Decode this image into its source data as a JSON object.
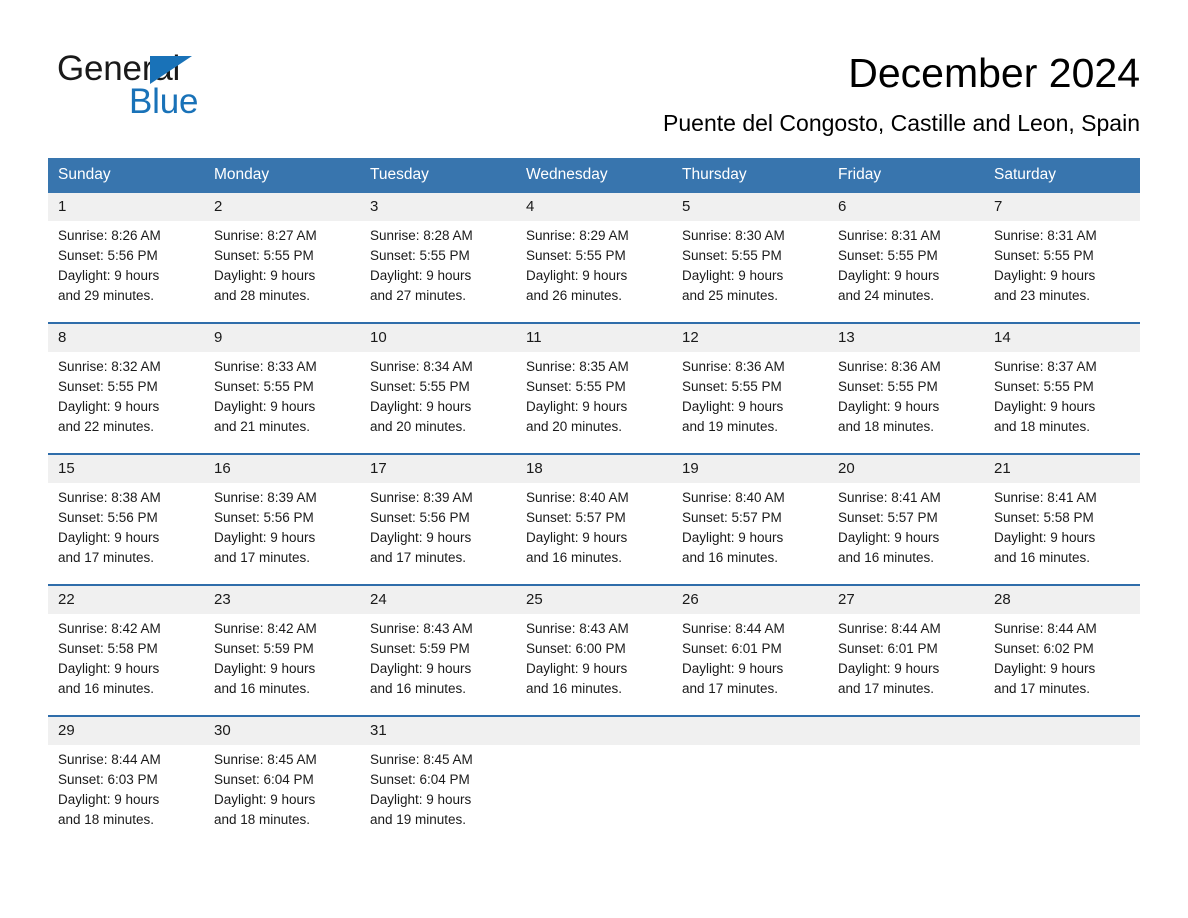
{
  "brand": {
    "name_part1": "General",
    "name_part2": "Blue",
    "triangle_color": "#1972b8"
  },
  "header": {
    "title": "December 2024",
    "subtitle": "Puente del Congosto, Castille and Leon, Spain"
  },
  "theme": {
    "header_blue": "#3875ae",
    "rule_blue": "#2f6daa",
    "daynum_band": "#f0f0f0",
    "text": "#1a1a1a"
  },
  "calendar": {
    "weekday_headers": [
      "Sunday",
      "Monday",
      "Tuesday",
      "Wednesday",
      "Thursday",
      "Friday",
      "Saturday"
    ],
    "weeks": [
      [
        {
          "day": "1",
          "sunrise": "Sunrise: 8:26 AM",
          "sunset": "Sunset: 5:56 PM",
          "daylight1": "Daylight: 9 hours",
          "daylight2": "and 29 minutes."
        },
        {
          "day": "2",
          "sunrise": "Sunrise: 8:27 AM",
          "sunset": "Sunset: 5:55 PM",
          "daylight1": "Daylight: 9 hours",
          "daylight2": "and 28 minutes."
        },
        {
          "day": "3",
          "sunrise": "Sunrise: 8:28 AM",
          "sunset": "Sunset: 5:55 PM",
          "daylight1": "Daylight: 9 hours",
          "daylight2": "and 27 minutes."
        },
        {
          "day": "4",
          "sunrise": "Sunrise: 8:29 AM",
          "sunset": "Sunset: 5:55 PM",
          "daylight1": "Daylight: 9 hours",
          "daylight2": "and 26 minutes."
        },
        {
          "day": "5",
          "sunrise": "Sunrise: 8:30 AM",
          "sunset": "Sunset: 5:55 PM",
          "daylight1": "Daylight: 9 hours",
          "daylight2": "and 25 minutes."
        },
        {
          "day": "6",
          "sunrise": "Sunrise: 8:31 AM",
          "sunset": "Sunset: 5:55 PM",
          "daylight1": "Daylight: 9 hours",
          "daylight2": "and 24 minutes."
        },
        {
          "day": "7",
          "sunrise": "Sunrise: 8:31 AM",
          "sunset": "Sunset: 5:55 PM",
          "daylight1": "Daylight: 9 hours",
          "daylight2": "and 23 minutes."
        }
      ],
      [
        {
          "day": "8",
          "sunrise": "Sunrise: 8:32 AM",
          "sunset": "Sunset: 5:55 PM",
          "daylight1": "Daylight: 9 hours",
          "daylight2": "and 22 minutes."
        },
        {
          "day": "9",
          "sunrise": "Sunrise: 8:33 AM",
          "sunset": "Sunset: 5:55 PM",
          "daylight1": "Daylight: 9 hours",
          "daylight2": "and 21 minutes."
        },
        {
          "day": "10",
          "sunrise": "Sunrise: 8:34 AM",
          "sunset": "Sunset: 5:55 PM",
          "daylight1": "Daylight: 9 hours",
          "daylight2": "and 20 minutes."
        },
        {
          "day": "11",
          "sunrise": "Sunrise: 8:35 AM",
          "sunset": "Sunset: 5:55 PM",
          "daylight1": "Daylight: 9 hours",
          "daylight2": "and 20 minutes."
        },
        {
          "day": "12",
          "sunrise": "Sunrise: 8:36 AM",
          "sunset": "Sunset: 5:55 PM",
          "daylight1": "Daylight: 9 hours",
          "daylight2": "and 19 minutes."
        },
        {
          "day": "13",
          "sunrise": "Sunrise: 8:36 AM",
          "sunset": "Sunset: 5:55 PM",
          "daylight1": "Daylight: 9 hours",
          "daylight2": "and 18 minutes."
        },
        {
          "day": "14",
          "sunrise": "Sunrise: 8:37 AM",
          "sunset": "Sunset: 5:55 PM",
          "daylight1": "Daylight: 9 hours",
          "daylight2": "and 18 minutes."
        }
      ],
      [
        {
          "day": "15",
          "sunrise": "Sunrise: 8:38 AM",
          "sunset": "Sunset: 5:56 PM",
          "daylight1": "Daylight: 9 hours",
          "daylight2": "and 17 minutes."
        },
        {
          "day": "16",
          "sunrise": "Sunrise: 8:39 AM",
          "sunset": "Sunset: 5:56 PM",
          "daylight1": "Daylight: 9 hours",
          "daylight2": "and 17 minutes."
        },
        {
          "day": "17",
          "sunrise": "Sunrise: 8:39 AM",
          "sunset": "Sunset: 5:56 PM",
          "daylight1": "Daylight: 9 hours",
          "daylight2": "and 17 minutes."
        },
        {
          "day": "18",
          "sunrise": "Sunrise: 8:40 AM",
          "sunset": "Sunset: 5:57 PM",
          "daylight1": "Daylight: 9 hours",
          "daylight2": "and 16 minutes."
        },
        {
          "day": "19",
          "sunrise": "Sunrise: 8:40 AM",
          "sunset": "Sunset: 5:57 PM",
          "daylight1": "Daylight: 9 hours",
          "daylight2": "and 16 minutes."
        },
        {
          "day": "20",
          "sunrise": "Sunrise: 8:41 AM",
          "sunset": "Sunset: 5:57 PM",
          "daylight1": "Daylight: 9 hours",
          "daylight2": "and 16 minutes."
        },
        {
          "day": "21",
          "sunrise": "Sunrise: 8:41 AM",
          "sunset": "Sunset: 5:58 PM",
          "daylight1": "Daylight: 9 hours",
          "daylight2": "and 16 minutes."
        }
      ],
      [
        {
          "day": "22",
          "sunrise": "Sunrise: 8:42 AM",
          "sunset": "Sunset: 5:58 PM",
          "daylight1": "Daylight: 9 hours",
          "daylight2": "and 16 minutes."
        },
        {
          "day": "23",
          "sunrise": "Sunrise: 8:42 AM",
          "sunset": "Sunset: 5:59 PM",
          "daylight1": "Daylight: 9 hours",
          "daylight2": "and 16 minutes."
        },
        {
          "day": "24",
          "sunrise": "Sunrise: 8:43 AM",
          "sunset": "Sunset: 5:59 PM",
          "daylight1": "Daylight: 9 hours",
          "daylight2": "and 16 minutes."
        },
        {
          "day": "25",
          "sunrise": "Sunrise: 8:43 AM",
          "sunset": "Sunset: 6:00 PM",
          "daylight1": "Daylight: 9 hours",
          "daylight2": "and 16 minutes."
        },
        {
          "day": "26",
          "sunrise": "Sunrise: 8:44 AM",
          "sunset": "Sunset: 6:01 PM",
          "daylight1": "Daylight: 9 hours",
          "daylight2": "and 17 minutes."
        },
        {
          "day": "27",
          "sunrise": "Sunrise: 8:44 AM",
          "sunset": "Sunset: 6:01 PM",
          "daylight1": "Daylight: 9 hours",
          "daylight2": "and 17 minutes."
        },
        {
          "day": "28",
          "sunrise": "Sunrise: 8:44 AM",
          "sunset": "Sunset: 6:02 PM",
          "daylight1": "Daylight: 9 hours",
          "daylight2": "and 17 minutes."
        }
      ],
      [
        {
          "day": "29",
          "sunrise": "Sunrise: 8:44 AM",
          "sunset": "Sunset: 6:03 PM",
          "daylight1": "Daylight: 9 hours",
          "daylight2": "and 18 minutes."
        },
        {
          "day": "30",
          "sunrise": "Sunrise: 8:45 AM",
          "sunset": "Sunset: 6:04 PM",
          "daylight1": "Daylight: 9 hours",
          "daylight2": "and 18 minutes."
        },
        {
          "day": "31",
          "sunrise": "Sunrise: 8:45 AM",
          "sunset": "Sunset: 6:04 PM",
          "daylight1": "Daylight: 9 hours",
          "daylight2": "and 19 minutes."
        },
        {
          "day": "",
          "sunrise": "",
          "sunset": "",
          "daylight1": "",
          "daylight2": ""
        },
        {
          "day": "",
          "sunrise": "",
          "sunset": "",
          "daylight1": "",
          "daylight2": ""
        },
        {
          "day": "",
          "sunrise": "",
          "sunset": "",
          "daylight1": "",
          "daylight2": ""
        },
        {
          "day": "",
          "sunrise": "",
          "sunset": "",
          "daylight1": "",
          "daylight2": ""
        }
      ]
    ]
  }
}
